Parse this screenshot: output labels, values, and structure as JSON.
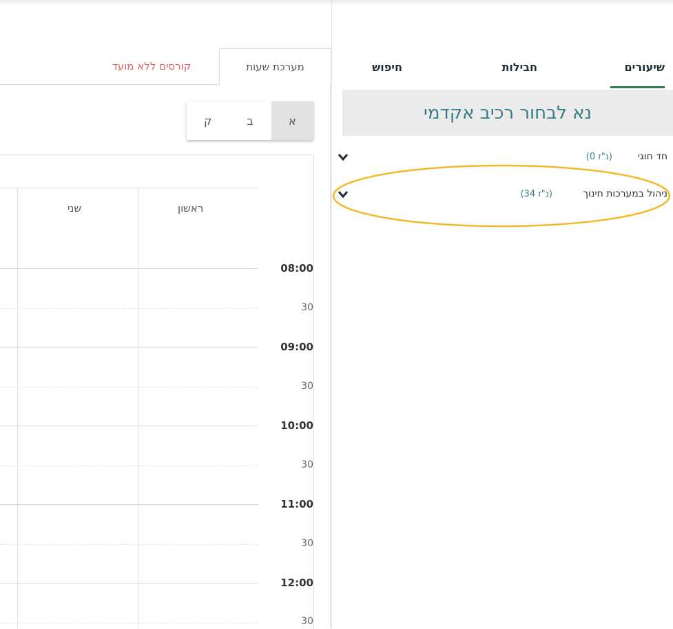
{
  "nav": {
    "tabs": [
      {
        "label": "שיעורים",
        "active": true
      },
      {
        "label": "חבילות",
        "active": false
      },
      {
        "label": "חיפוש",
        "active": false
      }
    ]
  },
  "sidebar": {
    "banner": "נא לבחור רכיב אקדמי",
    "programs": [
      {
        "name": "חד חוגי",
        "credits": "(0 נ\"ז)",
        "expanded": false
      },
      {
        "name": "ניהול במערכות חינוך",
        "credits": "(34 נ\"ז)",
        "expanded": false,
        "highlighted": true
      }
    ],
    "highlight_color": "#f5b82a"
  },
  "timetable": {
    "tabs": [
      {
        "label": "מערכת שעות",
        "active": true
      },
      {
        "label": "קורסים ללא מועד",
        "active": false
      }
    ],
    "semesters": [
      {
        "label": "א",
        "active": true
      },
      {
        "label": "ב",
        "active": false
      },
      {
        "label": "ק",
        "active": false
      }
    ],
    "days": [
      "ראשון",
      "שני"
    ],
    "times": [
      "08:00",
      "30",
      "09:00",
      "30",
      "10:00",
      "30",
      "11:00",
      "30",
      "12:00",
      "30"
    ]
  },
  "colors": {
    "accent_green": "#2e7a4f",
    "banner_text": "#3a7c85",
    "link_red": "#e06060"
  }
}
